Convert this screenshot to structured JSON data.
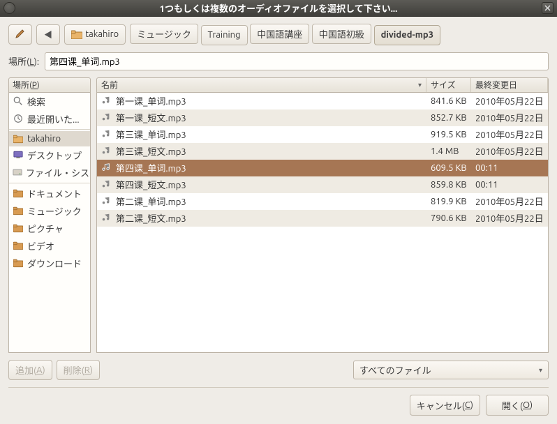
{
  "titlebar": {
    "title": "1つもしくは複数のオーディオファイルを選択して下さい..."
  },
  "breadcrumb": {
    "home_name": "takahiro",
    "segs": [
      "ミュージック",
      "Training",
      "中国語講座",
      "中国語初級",
      "divided-mp3"
    ],
    "current_index": 4
  },
  "location": {
    "label_pre": "場所(",
    "label_key": "L",
    "label_post": "):",
    "value": "第四课_单词.mp3"
  },
  "places": {
    "header_pre": "場所(",
    "header_key": "P",
    "header_post": ")",
    "items_top": [
      {
        "icon": "search",
        "label": "検索"
      },
      {
        "icon": "recent",
        "label": "最近開いた..."
      }
    ],
    "items_mid": [
      {
        "icon": "home",
        "label": "takahiro",
        "selected": true
      },
      {
        "icon": "desktop",
        "label": "デスクトップ"
      },
      {
        "icon": "disk",
        "label": "ファイル・シス..."
      }
    ],
    "items_bot": [
      {
        "icon": "folder",
        "label": "ドキュメント"
      },
      {
        "icon": "folder",
        "label": "ミュージック"
      },
      {
        "icon": "folder",
        "label": "ピクチャ"
      },
      {
        "icon": "folder",
        "label": "ビデオ"
      },
      {
        "icon": "folder",
        "label": "ダウンロード"
      }
    ]
  },
  "filelist": {
    "headers": {
      "name": "名前",
      "size": "サイズ",
      "date": "最終変更日"
    },
    "rows": [
      {
        "name": "第一课_单词.mp3",
        "size": "841.6 KB",
        "date": "2010年05月22日"
      },
      {
        "name": "第一课_短文.mp3",
        "size": "852.7 KB",
        "date": "2010年05月22日"
      },
      {
        "name": "第三课_单词.mp3",
        "size": "919.5 KB",
        "date": "2010年05月22日"
      },
      {
        "name": "第三课_短文.mp3",
        "size": "1.4 MB",
        "date": "2010年05月22日"
      },
      {
        "name": "第四课_单词.mp3",
        "size": "609.5 KB",
        "date": "00:11",
        "selected": true
      },
      {
        "name": "第四课_短文.mp3",
        "size": "859.8 KB",
        "date": "00:11"
      },
      {
        "name": "第二课_单词.mp3",
        "size": "819.9 KB",
        "date": "2010年05月22日"
      },
      {
        "name": "第二课_短文.mp3",
        "size": "790.6 KB",
        "date": "2010年05月22日"
      }
    ]
  },
  "bottom": {
    "add_pre": "追加(",
    "add_key": "A",
    "add_post": ")",
    "remove_pre": "削除(",
    "remove_key": "R",
    "remove_post": ")",
    "filter": "すべてのファイル"
  },
  "dialog": {
    "cancel_pre": "キャンセル(",
    "cancel_key": "C",
    "cancel_post": ")",
    "open_pre": "開く(",
    "open_key": "O",
    "open_post": ")"
  }
}
